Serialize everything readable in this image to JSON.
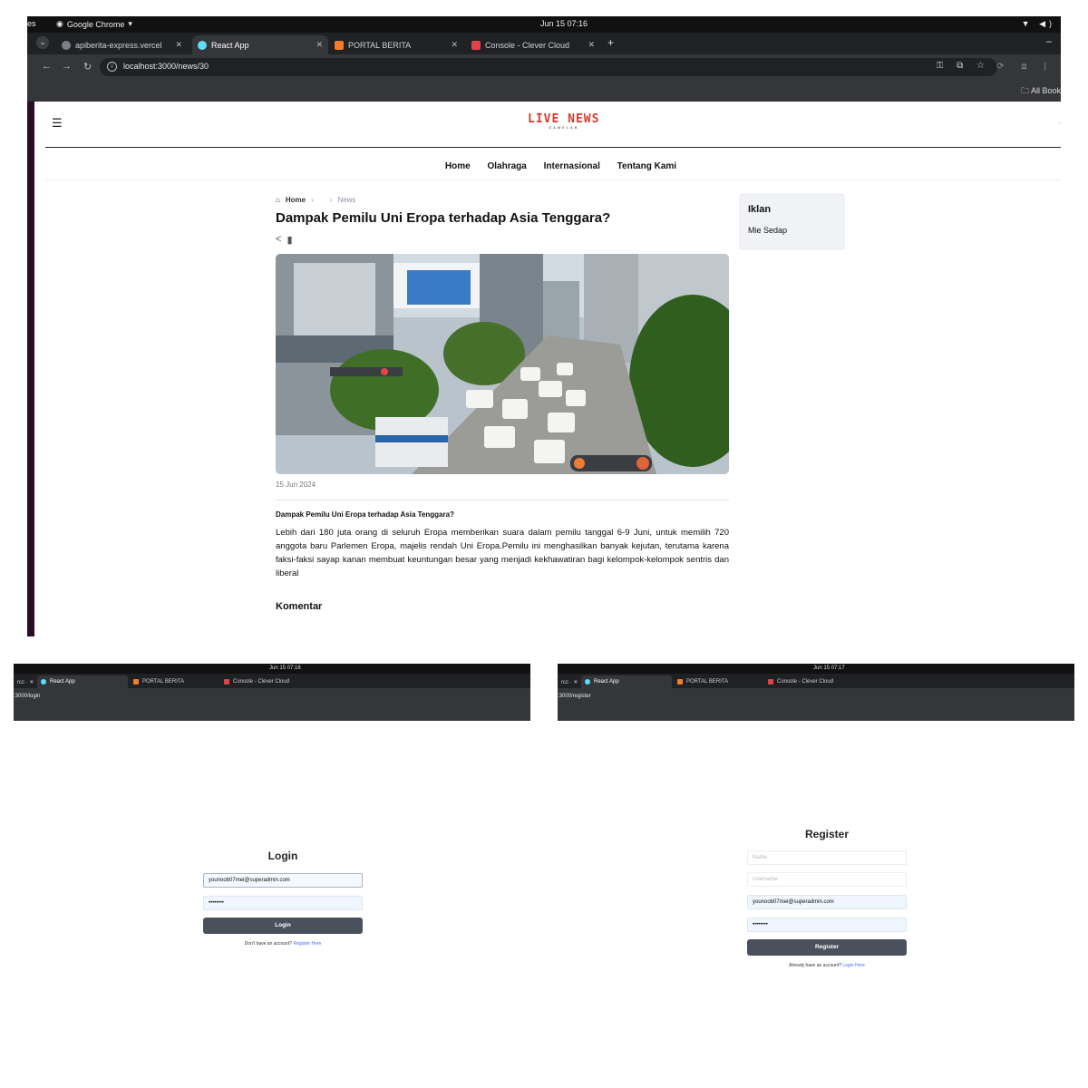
{
  "main": {
    "os": {
      "apps": "es",
      "chrome_label": "Google Chrome",
      "clock": "Jun 15  07:16"
    },
    "tabs": [
      {
        "label": "apiberita-express.vercel",
        "fav": "#7c7f86"
      },
      {
        "label": "React App",
        "fav": "#61dafb"
      },
      {
        "label": "PORTAL BERITA",
        "fav": "#f57c2a"
      },
      {
        "label": "Console - Clever Cloud",
        "fav": "#e0424b"
      }
    ],
    "url": "localhost:3000/news/30",
    "bookmarks_label": "All Book",
    "site": {
      "logo_main": "LIVE NEWS",
      "logo_sub": "GAMELAB",
      "nav": [
        "Home",
        "Olahraga",
        "Internasional",
        "Tentang Kami"
      ]
    },
    "breadcrumb": {
      "home": "Home",
      "current": "News"
    },
    "article": {
      "title": "Dampak Pemilu Uni Eropa terhadap Asia Tenggara?",
      "date": "15 Jun 2024",
      "lead": "Dampak Pemilu Uni Eropa terhadap Asia Tenggara?",
      "body": "Lebih dari 180 juta orang di seluruh Eropa memberikan suara dalam pemilu tanggal 6-9 Juni, untuk memilih 720 anggota baru Parlemen Eropa, majelis rendah Uni Eropa.Pemilu ini menghasilkan banyak kejutan, terutama karena faksi-faksi sayap kanan membuat keuntungan besar yang menjadi kekhawatiran bagi kelompok-kelompok sentris dan liberal",
      "comments_heading": "Komentar"
    },
    "ad": {
      "heading": "Iklan",
      "text": "Mie Sedap"
    }
  },
  "login": {
    "clock": "Jun 15  07:16",
    "tabs": [
      "React App",
      "PORTAL BERITA",
      "Console - Clever Cloud"
    ],
    "url": ":3000/login",
    "title": "Login",
    "email": "younoob07mei@superadmin.com",
    "password": "••••••••",
    "button": "Login",
    "note": "Don't have an account?",
    "link": "Register Here"
  },
  "register": {
    "clock": "Jun 15  07:17",
    "tabs": [
      "React App",
      "PORTAL BERITA",
      "Console - Clever Cloud"
    ],
    "url": ":3000/register",
    "title": "Register",
    "name_placeholder": "Name",
    "username_placeholder": "Username",
    "email": "younoob07mei@superadmin.com",
    "password": "••••••••",
    "button": "Register",
    "note": "Already have an account?",
    "link": "Login Here"
  }
}
